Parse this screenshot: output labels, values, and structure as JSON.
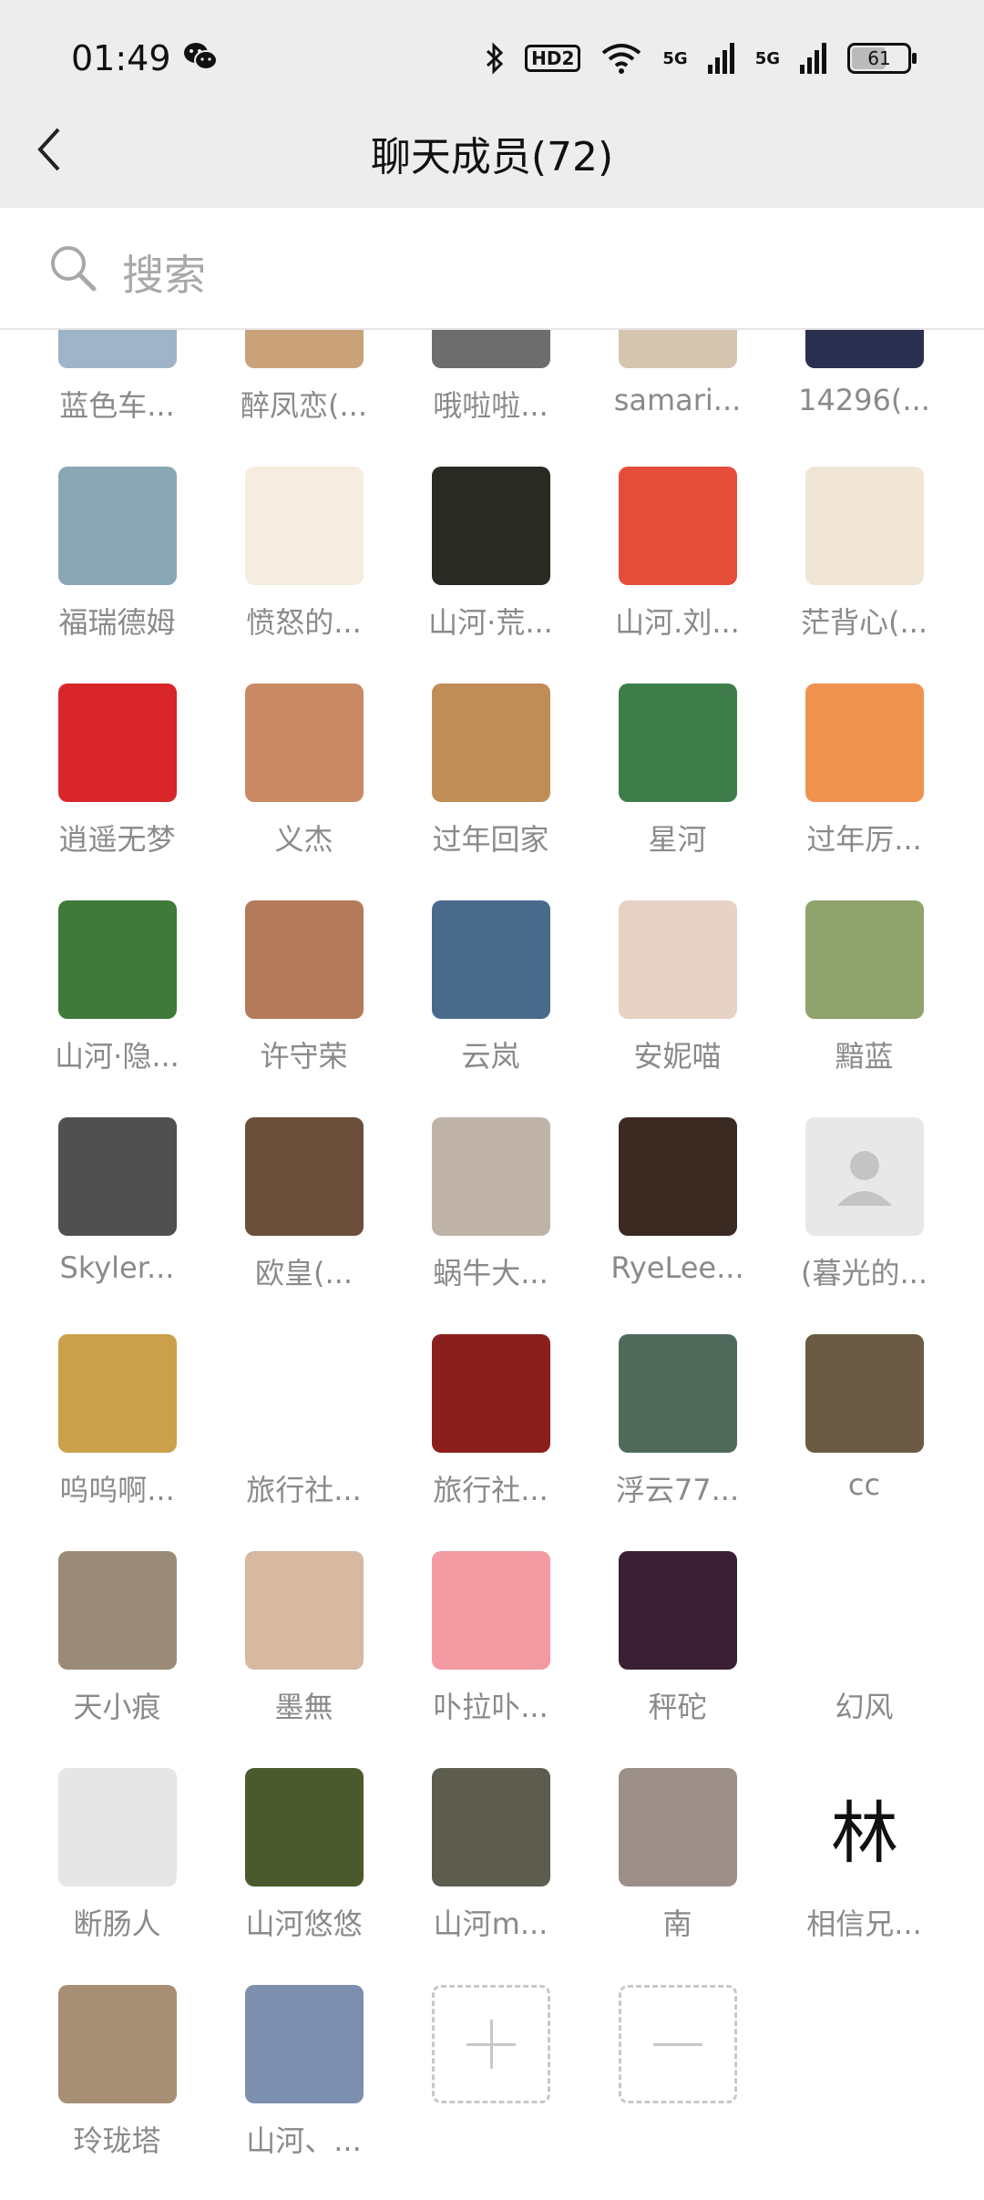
{
  "status_bar": {
    "time": "01:49",
    "hd": "HD2",
    "net1": "5G",
    "net2": "5G",
    "battery": "61"
  },
  "nav": {
    "title": "聊天成员(72)"
  },
  "search": {
    "placeholder": "搜索"
  },
  "members": [
    {
      "name": "蓝色车...",
      "color": "#9fb4c7"
    },
    {
      "name": "醉凤恋(...",
      "color": "#c9a27a"
    },
    {
      "name": "哦啦啦...",
      "color": "#6d6d6d"
    },
    {
      "name": "samari...",
      "color": "#d5c4b0"
    },
    {
      "name": "14296(...",
      "color": "#2b3050"
    },
    {
      "name": "福瑞德姆",
      "color": "#8aa7b6"
    },
    {
      "name": "愤怒的...",
      "color": "#f4ede0"
    },
    {
      "name": "山河·荒...",
      "color": "#2a2a24"
    },
    {
      "name": "山河.刘...",
      "color": "#e44d3a"
    },
    {
      "name": "茫背心(...",
      "color": "#f1e6d6"
    },
    {
      "name": "逍遥无梦",
      "color": "#d8262a"
    },
    {
      "name": "义杰",
      "color": "#c98a64"
    },
    {
      "name": "过年回家",
      "color": "#c18d56"
    },
    {
      "name": "星河",
      "color": "#3e7d4a"
    },
    {
      "name": "过年厉...",
      "color": "#f0934f"
    },
    {
      "name": "山河·隐...",
      "color": "#3f7a3a"
    },
    {
      "name": "许守荣",
      "color": "#b47a5c"
    },
    {
      "name": "云岚",
      "color": "#4a6a8c"
    },
    {
      "name": "安妮喵",
      "color": "#e7d2c6"
    },
    {
      "name": "黯蓝",
      "color": "#8fa36d"
    },
    {
      "name": "Skyler...",
      "color": "#505050"
    },
    {
      "name": "欧皇(...",
      "color": "#6b4f3a"
    },
    {
      "name": "蜗牛大...",
      "color": "#bfb3a8"
    },
    {
      "name": "RyeLee...",
      "color": "#3b2a22"
    },
    {
      "name": "(暮光的...",
      "color": "#e8e8e8"
    },
    {
      "name": "呜呜啊...",
      "color": "#caa04a"
    },
    {
      "name": "旅行社...",
      "color": "#ffffff"
    },
    {
      "name": "旅行社...",
      "color": "#8a1f1c"
    },
    {
      "name": "浮云77...",
      "color": "#4f6a5b"
    },
    {
      "name": "cc",
      "color": "#6b5a44"
    },
    {
      "name": "天小痕",
      "color": "#9a8a78"
    },
    {
      "name": "墨無",
      "color": "#d7b8a0"
    },
    {
      "name": "卟拉卟...",
      "color": "#f39aa3"
    },
    {
      "name": "秤砣",
      "color": "#3a1f35"
    },
    {
      "name": "幻风",
      "color": "#ffffff"
    },
    {
      "name": "断肠人",
      "color": "#e6e6e6"
    },
    {
      "name": "山河悠悠",
      "color": "#4a5a2c"
    },
    {
      "name": "山河m...",
      "color": "#5d5d4f"
    },
    {
      "name": "南",
      "color": "#9b8f88"
    },
    {
      "name": "相信兄...",
      "color": "#ffffff",
      "char": "林"
    },
    {
      "name": "玲珑塔",
      "color": "#a78f75"
    },
    {
      "name": "山河、...",
      "color": "#7d8fae"
    }
  ]
}
